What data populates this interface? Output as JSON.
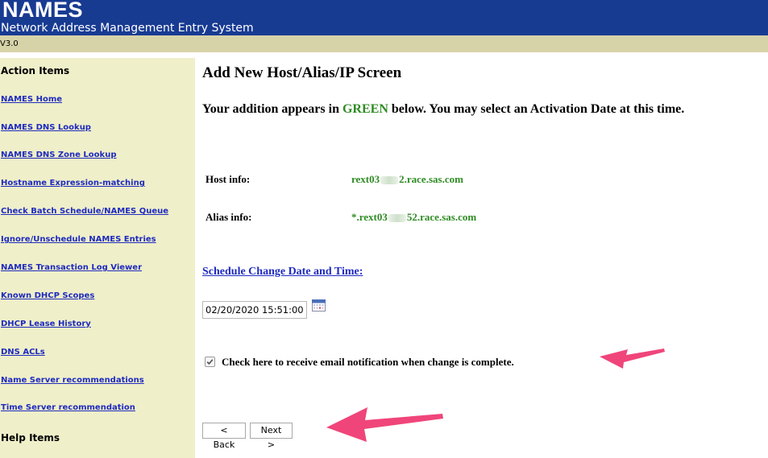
{
  "header": {
    "title": "NAMES",
    "subtitle": "Network Address Management Entry System",
    "version": "V3.0",
    "color": "#183b92"
  },
  "sidebar": {
    "heading": "Action Items",
    "items": [
      {
        "label": "NAMES Home"
      },
      {
        "label": "NAMES DNS Lookup"
      },
      {
        "label": "NAMES DNS Zone Lookup"
      },
      {
        "label": "Hostname Expression-matching"
      },
      {
        "label": "Check Batch Schedule/NAMES Queue"
      },
      {
        "label": "Ignore/Unschedule NAMES Entries"
      },
      {
        "label": "NAMES Transaction Log Viewer"
      },
      {
        "label": "Known DHCP Scopes"
      },
      {
        "label": "DHCP Lease History"
      },
      {
        "label": "DNS ACLs"
      },
      {
        "label": "Name Server recommendations"
      },
      {
        "label": "Time Server recommendation"
      }
    ],
    "help_heading": "Help Items",
    "background": "#efefc9"
  },
  "main": {
    "title": "Add New Host/Alias/IP Screen",
    "message": {
      "prefix": "Your addition appears in ",
      "highlight": "GREEN",
      "suffix": " below. You may select an Activation Date at this time."
    },
    "host_info": {
      "label": "Host info:",
      "value_start": "rext03",
      "value_end": "2.race.sas.com"
    },
    "alias_info": {
      "label": "Alias info:",
      "value_start": "*.rext03",
      "value_end": "52.race.sas.com"
    },
    "schedule_link": "Schedule Change Date and Time:",
    "date_value": "02/20/2020 15:51:00",
    "calendar_icon": "calendar-icon",
    "notify_checked": true,
    "notify_label": "Check here to receive email notification when change is complete.",
    "back_label": "< Back",
    "next_label": "Next >",
    "highlight_color": "#2e8b23",
    "link_color": "#1f2bbf",
    "annotation_color": "#f0457a"
  }
}
